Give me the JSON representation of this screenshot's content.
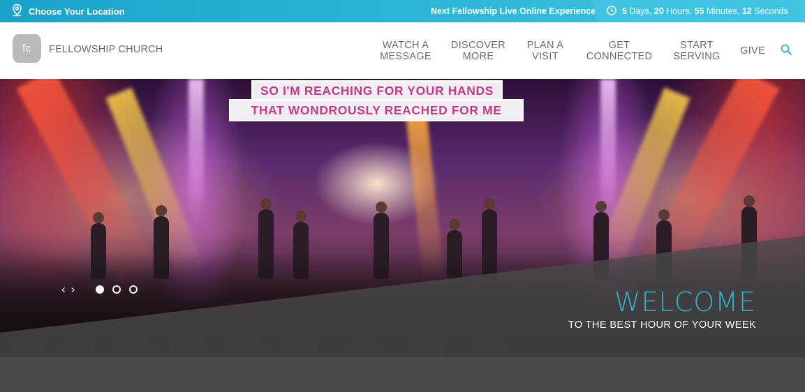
{
  "topbar": {
    "location_label": "Choose Your Location",
    "next_label": "Next Fellowship Live Online Experience",
    "countdown": {
      "days_value": "5",
      "days_unit": "Days,",
      "hours_value": "20",
      "hours_unit": "Hours,",
      "minutes_value": "55",
      "minutes_unit": "Minutes,",
      "seconds_value": "12",
      "seconds_unit": "Seconds"
    }
  },
  "header": {
    "logo_mark": "fc",
    "logo_text": "FELLOWSHIP CHURCH",
    "nav": [
      {
        "line1": "WATCH A",
        "line2": "MESSAGE"
      },
      {
        "line1": "DISCOVER",
        "line2": "MORE"
      },
      {
        "line1": "PLAN A",
        "line2": "VISIT"
      },
      {
        "line1": "GET",
        "line2": "CONNECTED"
      },
      {
        "line1": "START",
        "line2": "SERVING"
      },
      {
        "line1": "GIVE",
        "line2": ""
      }
    ]
  },
  "hero": {
    "banner_line1": "SO I'M REACHING FOR YOUR HANDS",
    "banner_line2": "THAT WONDROUSLY REACHED FOR ME",
    "title": "WELCOME",
    "subtitle": "TO THE BEST HOUR OF YOUR WEEK",
    "prev_arrow": "‹",
    "next_arrow": "›",
    "slide_count": 3,
    "active_slide": 1
  },
  "colors": {
    "accent": "#2ab2cf",
    "topbar": "#2cb6d7",
    "nav_text": "#6b6b6b",
    "banner_text": "#c33a8d"
  },
  "icons": {
    "location": "map-pin-icon",
    "clock": "clock-icon",
    "search": "search-icon"
  }
}
